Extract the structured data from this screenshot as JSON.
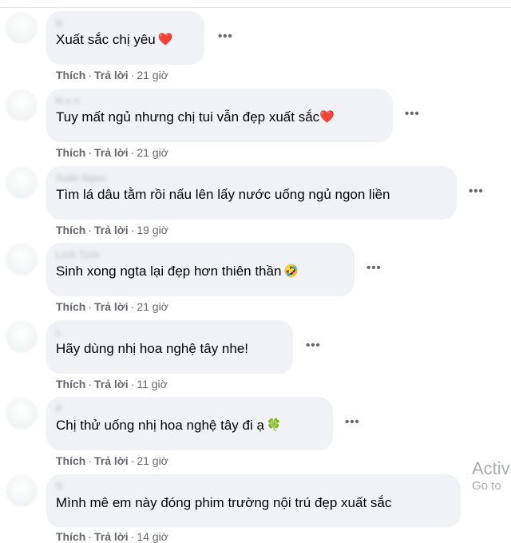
{
  "comments": [
    {
      "author": "N      ",
      "text": "Xuất sắc chị yêu",
      "emoji_icon": "red-heart-icon",
      "emoji_char": "❤️",
      "like_label": "Thích",
      "reply_label": "Trả lời",
      "time": "21 giờ",
      "more_label": "•••"
    },
    {
      "author": "N    n  n",
      "text": "Tuy mất ngủ nhưng chị tui vẫn đẹp xuất sắc",
      "emoji_icon": "red-heart-icon",
      "emoji_char": "❤️",
      "like_label": "Thích",
      "reply_label": "Trả lời",
      "time": "21 giờ",
      "more_label": "•••"
    },
    {
      "author": "Xuân   Ngọc",
      "text": "Tìm lá dâu tằm rồi nấu lên lấy nước uống ngủ ngon liền",
      "emoji_icon": "",
      "emoji_char": "",
      "like_label": "Thích",
      "reply_label": "Trả lời",
      "time": "19 giờ",
      "more_label": "•••"
    },
    {
      "author": "Linh Tịnh",
      "text": "Sinh xong ngta lại đẹp hơn thiên thần",
      "emoji_icon": "rolling-laughing-face-icon",
      "emoji_char": "🤣",
      "like_label": "Thích",
      "reply_label": "Trả lời",
      "time": "21 giờ",
      "more_label": "•••"
    },
    {
      "author": "L     ",
      "text": "Hãy dùng nhị hoa nghệ tây nhe!",
      "emoji_icon": "",
      "emoji_char": "",
      "like_label": "Thích",
      "reply_label": "Trả lời",
      "time": "11 giờ",
      "more_label": "•••"
    },
    {
      "author": "P        ",
      "text": "Chị thử uống nhị hoa nghệ tây đi ạ",
      "emoji_icon": "four-leaf-clover-icon",
      "emoji_char": "🍀",
      "like_label": "Thích",
      "reply_label": "Trả lời",
      "time": "21 giờ",
      "more_label": "•••"
    },
    {
      "author": "N       ",
      "text": "Mình mê em này đóng phim trường nội trú đẹp xuất sắc",
      "emoji_icon": "",
      "emoji_char": "",
      "like_label": "Thích",
      "reply_label": "Trả lời",
      "time": "14 giờ",
      "more_label": "•••"
    }
  ],
  "separator": "·",
  "watermark": {
    "line1": "Activ",
    "line2": "Go to"
  },
  "colors": {
    "bubble_bg": "#f0f2f5",
    "text": "#050505",
    "secondary_text": "#65676b",
    "heart": "#e41e3f"
  }
}
